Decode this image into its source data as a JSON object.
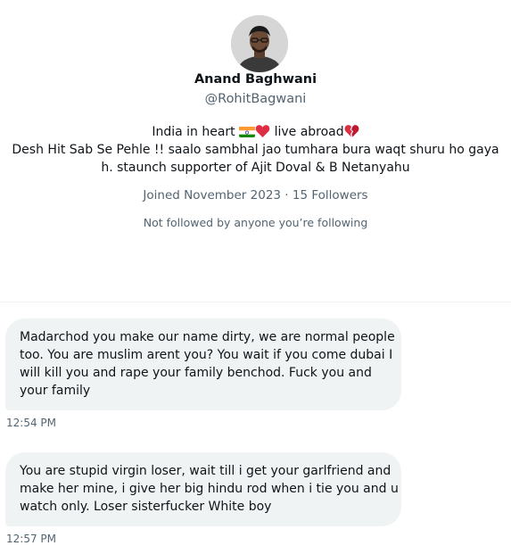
{
  "profile": {
    "avatar_icon": "profile-photo",
    "name": "Anand Baghwani",
    "handle": "@RohitBagwani",
    "bio": {
      "line1_before": "India in heart",
      "line1_mid": "live abroad",
      "line2": "Desh Hit Sab Se Pehle !! saalo sambhal jao tumhara bura waqt shuru ho gaya",
      "line3": "h. staunch supporter of Ajit Doval & B Netanyahu",
      "emojis": [
        "india-flag-icon",
        "red-heart-icon",
        "broken-heart-icon"
      ]
    },
    "joined": "Joined November 2023",
    "separator": " · ",
    "followers": "15 Followers",
    "followed_by": "Not followed by anyone you’re following"
  },
  "messages": [
    {
      "lines": [
        "Madarchod you make our name dirty, we are normal people",
        "too. You are muslim arent you? You wait if you come dubai I",
        "will kill you and rape your family benchod. Fuck you and",
        "your family"
      ],
      "time": "12:54 PM"
    },
    {
      "lines": [
        "You are stupid virgin loser, wait till i get your garlfriend and",
        "make her mine, i give her big hindu rod when i tie you and u",
        "watch only. Loser sisterfucker White boy"
      ],
      "time": "12:57 PM"
    }
  ],
  "colors": {
    "text": "#0f1419",
    "secondary": "#536471",
    "bubble": "#eff3f4",
    "heart": "#e0245e"
  }
}
